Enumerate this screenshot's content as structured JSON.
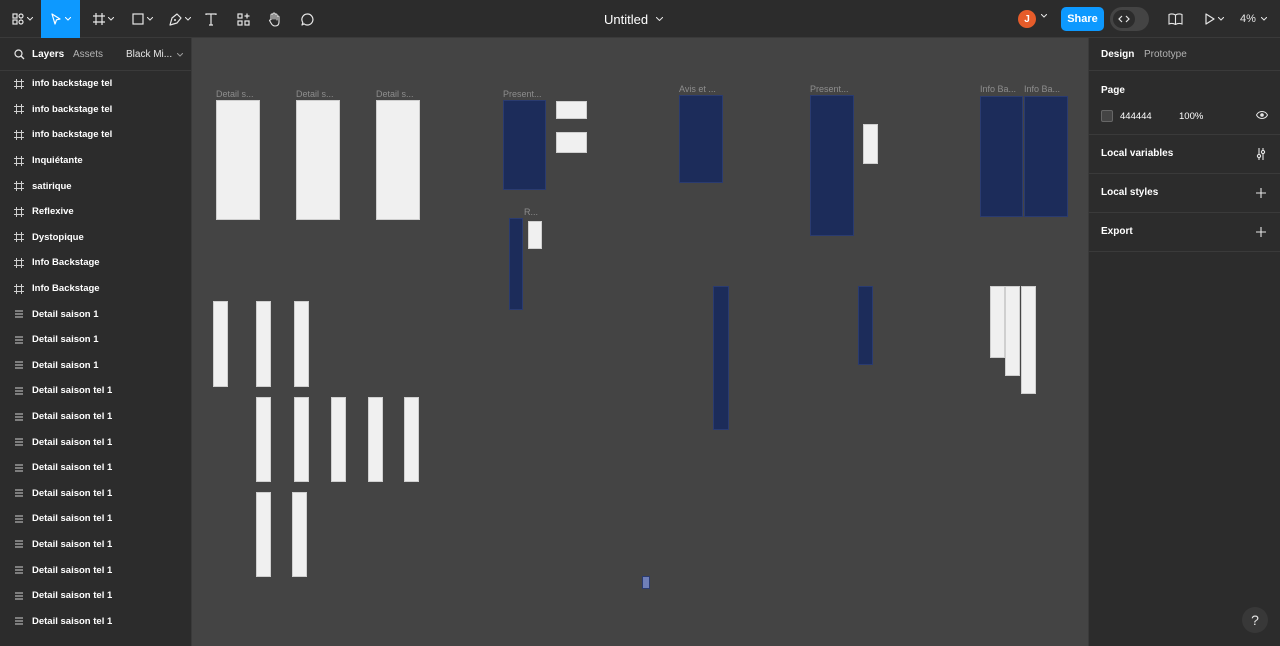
{
  "toolbar": {
    "title": "Untitled",
    "avatar_initial": "J",
    "share_label": "Share",
    "zoom_label": "4%",
    "tools": [
      "main-menu-icon",
      "move-tool-icon",
      "frame-tool-icon",
      "shape-tool-icon",
      "pen-tool-icon",
      "text-tool-icon",
      "components-icon",
      "hand-tool-icon",
      "comment-icon"
    ],
    "accent_color": "#0d99ff"
  },
  "left_panel": {
    "tabs": {
      "layers": "Layers",
      "assets": "Assets"
    },
    "page_selector": "Black Mi...",
    "layers": [
      {
        "label": "info backstage tel",
        "icon": "frame-icon"
      },
      {
        "label": "info backstage tel",
        "icon": "frame-icon"
      },
      {
        "label": "info backstage tel",
        "icon": "frame-icon"
      },
      {
        "label": "Inquiétante",
        "icon": "frame-icon"
      },
      {
        "label": "satirique",
        "icon": "frame-icon"
      },
      {
        "label": "Reflexive",
        "icon": "frame-icon"
      },
      {
        "label": "Dystopique",
        "icon": "frame-icon"
      },
      {
        "label": "Info Backstage",
        "icon": "frame-icon"
      },
      {
        "label": "Info Backstage",
        "icon": "frame-icon"
      },
      {
        "label": "Detail saison 1",
        "icon": "list-icon"
      },
      {
        "label": "Detail saison 1",
        "icon": "list-icon"
      },
      {
        "label": "Detail saison 1",
        "icon": "list-icon"
      },
      {
        "label": "Detail saison tel 1",
        "icon": "list-icon"
      },
      {
        "label": "Detail saison tel 1",
        "icon": "list-icon"
      },
      {
        "label": "Detail saison tel 1",
        "icon": "list-icon"
      },
      {
        "label": "Detail saison tel 1",
        "icon": "list-icon"
      },
      {
        "label": "Detail saison tel 1",
        "icon": "list-icon"
      },
      {
        "label": "Detail saison tel 1",
        "icon": "list-icon"
      },
      {
        "label": "Detail saison tel 1",
        "icon": "list-icon"
      },
      {
        "label": "Detail saison tel 1",
        "icon": "list-icon"
      },
      {
        "label": "Detail saison tel 1",
        "icon": "list-icon"
      },
      {
        "label": "Detail saison tel 1",
        "icon": "list-icon"
      }
    ]
  },
  "canvas": {
    "background": "#444444",
    "frame_labels": [
      "Detail s...",
      "Detail s...",
      "Detail s...",
      "Present...",
      "R...",
      "Avis et ...",
      "Present...",
      "Info Ba...",
      "Info Ba..."
    ]
  },
  "right_panel": {
    "tabs": {
      "design": "Design",
      "prototype": "Prototype"
    },
    "page_title": "Page",
    "page_color": "444444",
    "page_opacity": "100%",
    "sections": [
      "Local variables",
      "Local styles",
      "Export"
    ]
  },
  "help_label": "?"
}
